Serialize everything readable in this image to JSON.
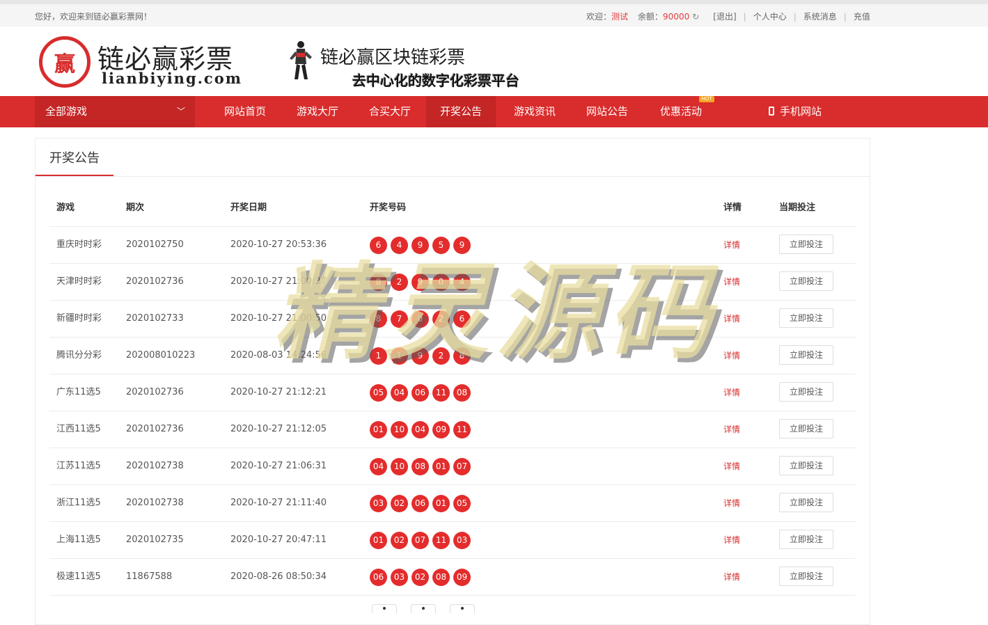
{
  "topbar": {
    "welcome": "您好，欢迎来到链必赢彩票网！",
    "greet_label": "欢迎：",
    "username": "测试",
    "balance_label": "余额：",
    "balance": "90000",
    "logout": "[退出]",
    "personal_center": "个人中心",
    "system_messages": "系统消息",
    "recharge": "充值"
  },
  "header": {
    "logo_glyph": "赢",
    "logo_title": "链必赢彩票",
    "logo_domain": "lianbiying.com",
    "slogan_title": "链必赢区块链彩票",
    "slogan_sub": "去中心化的数字化彩票平台"
  },
  "nav": {
    "all_games": "全部游戏",
    "items": [
      "网站首页",
      "游戏大厅",
      "合买大厅",
      "开奖公告",
      "游戏资讯",
      "网站公告",
      "优惠活动"
    ],
    "active": "开奖公告",
    "hot_badge": "HOT",
    "mobile": "手机网站"
  },
  "panel": {
    "title": "开奖公告",
    "columns": [
      "游戏",
      "期次",
      "开奖日期",
      "开奖号码",
      "详情",
      "当期投注"
    ],
    "detail_label": "详情",
    "bet_label": "立即投注",
    "rows": [
      {
        "game": "重庆时时彩",
        "issue": "2020102750",
        "date": "2020-10-27 20:53:36",
        "numbers": [
          "6",
          "4",
          "9",
          "5",
          "9"
        ]
      },
      {
        "game": "天津时时彩",
        "issue": "2020102736",
        "date": "2020-10-27 21:00:37",
        "numbers": [
          "8",
          "2",
          "9",
          "0",
          "4"
        ]
      },
      {
        "game": "新疆时时彩",
        "issue": "2020102733",
        "date": "2020-10-27 21:00:50",
        "numbers": [
          "8",
          "7",
          "0",
          "2",
          "6"
        ]
      },
      {
        "game": "腾讯分分彩",
        "issue": "202008010223",
        "date": "2020-08-03 14:24:56",
        "numbers": [
          "1",
          "1",
          "9",
          "2",
          "8"
        ]
      },
      {
        "game": "广东11选5",
        "issue": "2020102736",
        "date": "2020-10-27 21:12:21",
        "numbers": [
          "05",
          "04",
          "06",
          "11",
          "08"
        ]
      },
      {
        "game": "江西11选5",
        "issue": "2020102736",
        "date": "2020-10-27 21:12:05",
        "numbers": [
          "01",
          "10",
          "04",
          "09",
          "11"
        ]
      },
      {
        "game": "江苏11选5",
        "issue": "2020102738",
        "date": "2020-10-27 21:06:31",
        "numbers": [
          "04",
          "10",
          "08",
          "01",
          "07"
        ]
      },
      {
        "game": "浙江11选5",
        "issue": "2020102738",
        "date": "2020-10-27 21:11:40",
        "numbers": [
          "03",
          "02",
          "06",
          "01",
          "05"
        ]
      },
      {
        "game": "上海11选5",
        "issue": "2020102735",
        "date": "2020-10-27 20:47:11",
        "numbers": [
          "01",
          "02",
          "07",
          "11",
          "03"
        ]
      },
      {
        "game": "极速11选5",
        "issue": "11867588",
        "date": "2020-08-26 08:50:34",
        "numbers": [
          "06",
          "03",
          "02",
          "08",
          "09"
        ]
      }
    ]
  },
  "watermark": "精灵源码",
  "colors": {
    "brand_red": "#d92c2c",
    "ball_red": "#e42c2c"
  }
}
